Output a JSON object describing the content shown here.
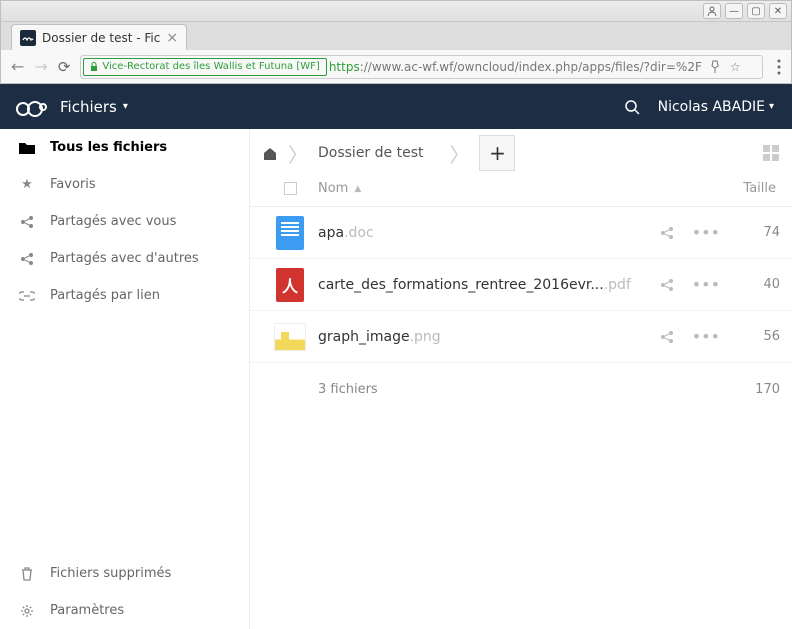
{
  "window": {
    "tab_title": "Dossier de test - Fic",
    "cert_label": "Vice-Rectorat des îles Wallis et Futuna [WF]",
    "url_https": "https",
    "url_rest": "://www.ac-wf.wf/owncloud/index.php/apps/files/?dir=%2F"
  },
  "header": {
    "app_label": "Fichiers",
    "user_name": "Nicolas ABADIE"
  },
  "sidebar": {
    "items": [
      {
        "label": "Tous les fichiers",
        "icon": "folder",
        "active": true
      },
      {
        "label": "Favoris",
        "icon": "star",
        "active": false
      },
      {
        "label": "Partagés avec vous",
        "icon": "share",
        "active": false
      },
      {
        "label": "Partagés avec d'autres",
        "icon": "share",
        "active": false
      },
      {
        "label": "Partagés par lien",
        "icon": "link",
        "active": false
      }
    ],
    "trash_label": "Fichiers supprimés",
    "settings_label": "Paramètres"
  },
  "breadcrumb": {
    "current": "Dossier de test"
  },
  "columns": {
    "name": "Nom",
    "size": "Taille"
  },
  "files": [
    {
      "name": "apa",
      "ext": ".doc",
      "size": "74",
      "thumb": "doc"
    },
    {
      "name": "carte_des_formations_rentree_2016evr...",
      "ext": ".pdf",
      "size": "40",
      "thumb": "pdf"
    },
    {
      "name": "graph_image",
      "ext": ".png",
      "size": "56",
      "thumb": "img"
    }
  ],
  "summary": {
    "count_label": "3 fichiers",
    "total_size": "170"
  }
}
